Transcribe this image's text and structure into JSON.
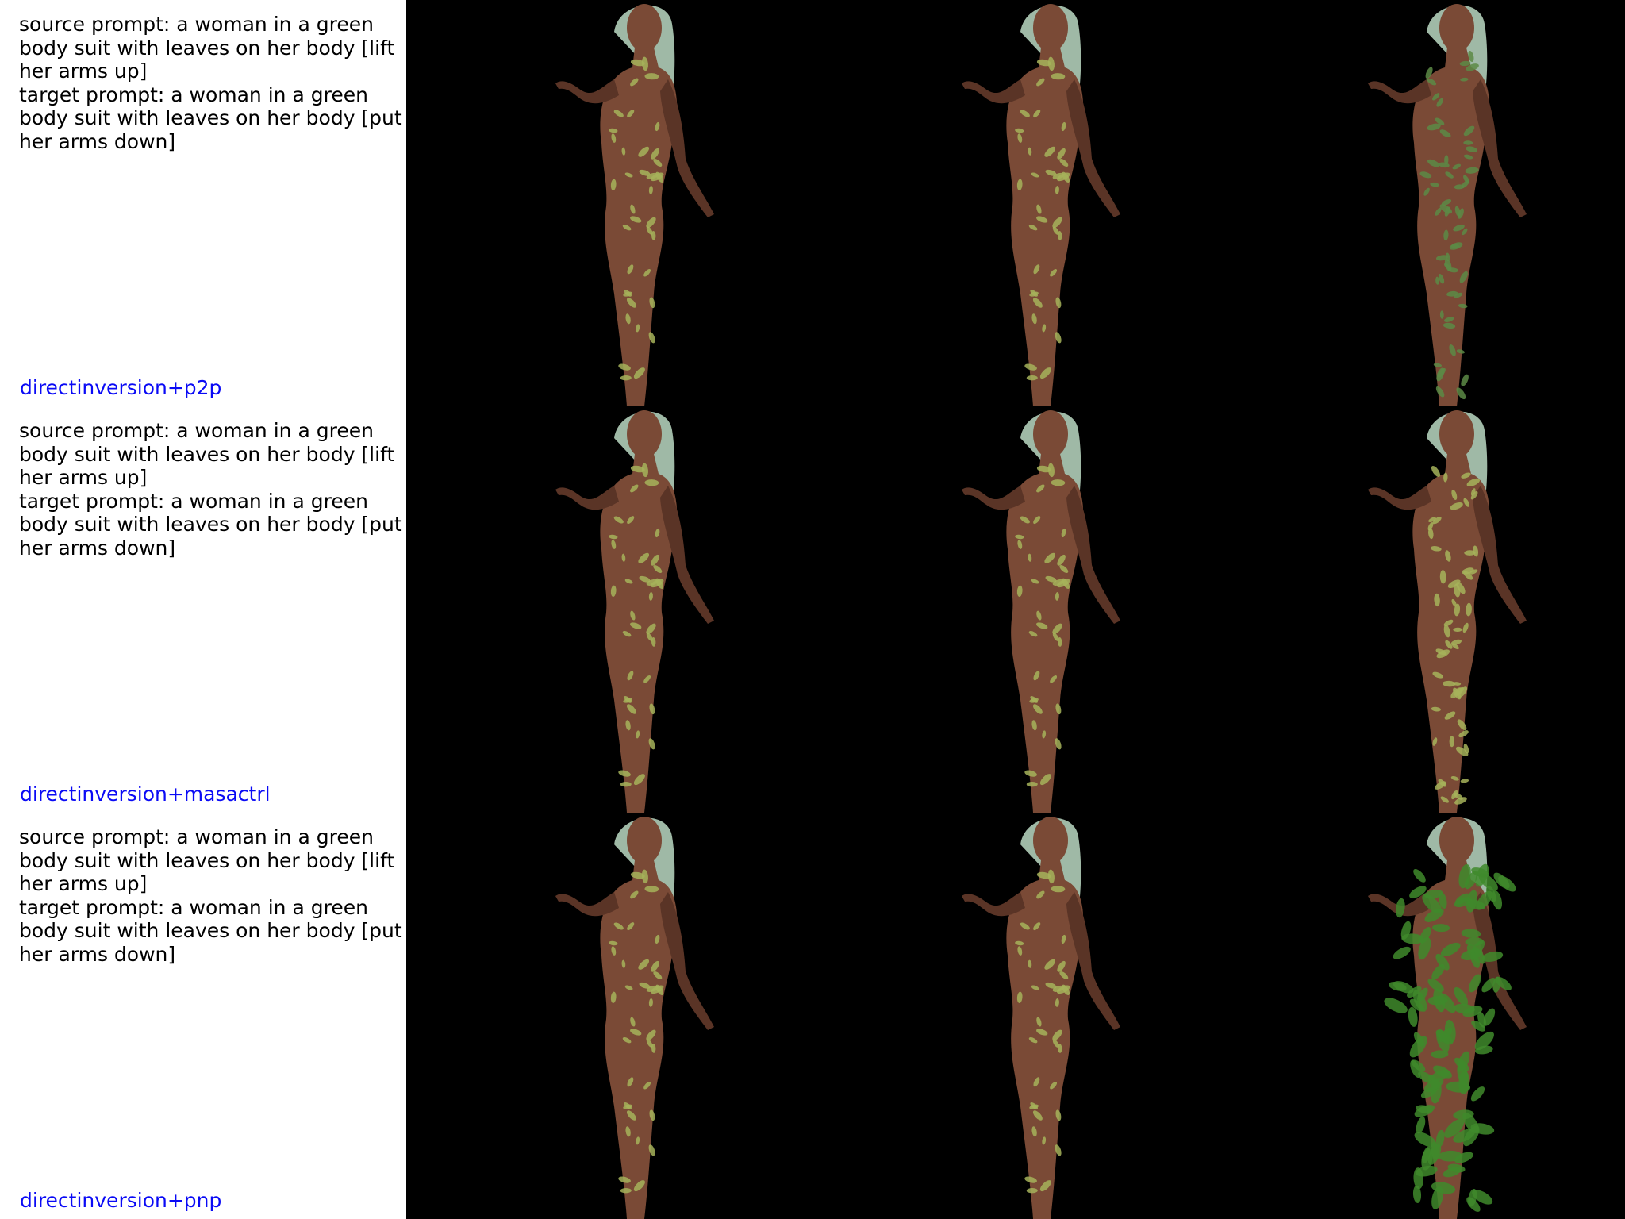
{
  "colors": {
    "method_label": "#0a0af5",
    "prompt_text": "#000000",
    "panel_bg": "#000000"
  },
  "rows": [
    {
      "source_prompt": "source prompt: a woman in a green body suit with leaves on her body [lift her arms up]",
      "target_prompt": "target prompt: a woman in a green body suit with leaves on her body [put her arms down]",
      "method": "directinversion+p2p"
    },
    {
      "source_prompt": "source prompt: a woman in a green body suit with leaves on her body [lift her arms up]",
      "target_prompt": "target prompt: a woman in a green body suit with leaves on her body [put her arms down]",
      "method": "directinversion+masactrl"
    },
    {
      "source_prompt": "source prompt: a woman in a green body suit with leaves on her body [lift her arms up]",
      "target_prompt": "target prompt: a woman in a green body suit with leaves on her body [put her arms down]",
      "method": "directinversion+pnp"
    }
  ],
  "panels": {
    "source_image": "source-image",
    "reconstruction_image": "reconstruction-image",
    "edited_image": "edited-image"
  }
}
